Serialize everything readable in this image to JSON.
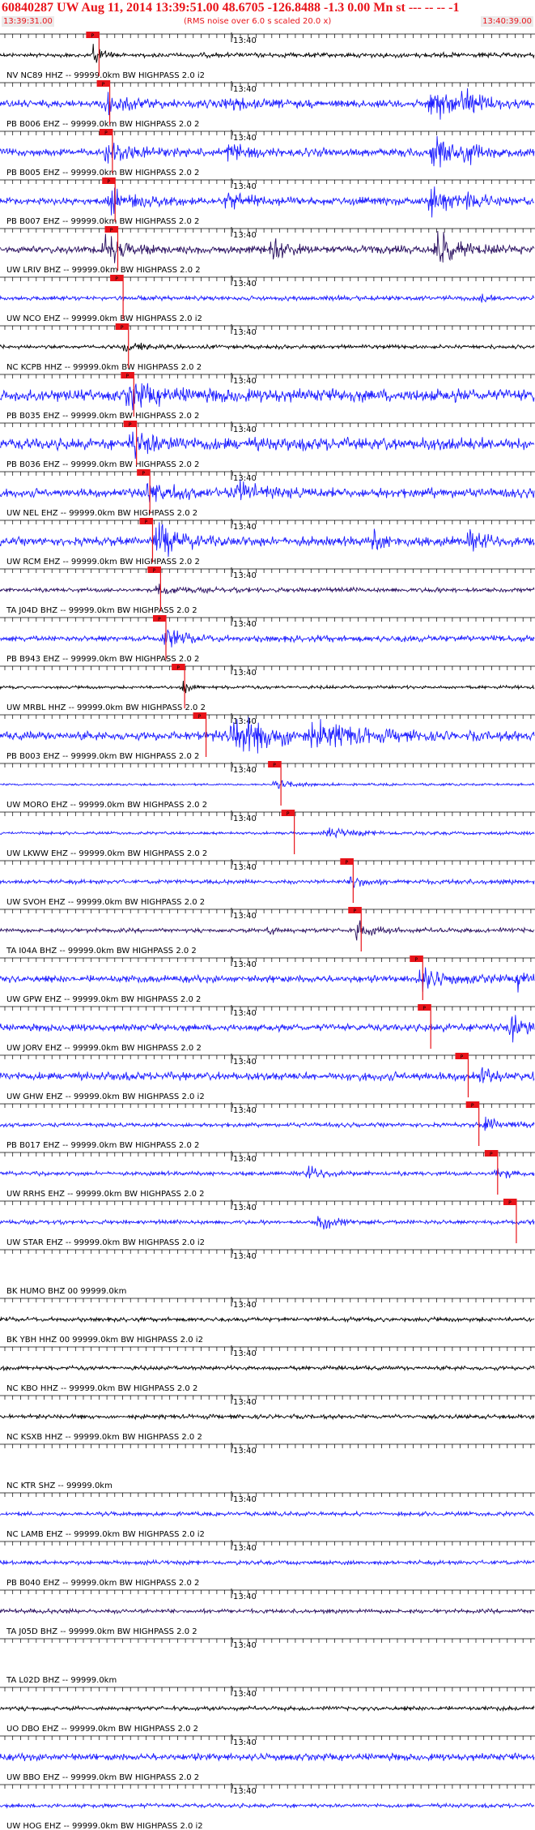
{
  "header": {
    "title": "60840287 UW Aug 11, 2014 13:39:51.00   48.6705 -126.8488 -1.3 0.00 Mn st --- -- --  -1",
    "start_time": "13:39:31.00",
    "rms_note": "(RMS noise over 6.0 s scaled 20.0 x)",
    "end_time": "13:40:39.00"
  },
  "colors": {
    "black": "#000000",
    "blue": "#1a1aff",
    "purple": "#2a1060",
    "pick": "#e8141a",
    "background": "#ffffff"
  },
  "chart_data": {
    "type": "line",
    "title": "60840287 UW Aug 11, 2014 13:39:51.00   48.6705 -126.8488 -1.3 0.00 Mn st --- -- --  -1",
    "x_start": "13:39:31.00",
    "x_end": "13:40:39.00",
    "x_tick_label": "13:40",
    "grid": false,
    "pick_label": "P",
    "traces": [
      {
        "label": "NV NC89 HHZ -- 99999.0km BW  HIGHPASS  2.0 i2",
        "color": "black",
        "amp": 3,
        "pick": 0.17,
        "events": [
          [
            0.175,
            14,
            0.018
          ]
        ]
      },
      {
        "label": "PB B006 EHZ -- 99999.0km BW  HIGHPASS  2.0  2",
        "color": "blue",
        "amp": 5,
        "pick": 0.19,
        "events": [
          [
            0.2,
            12,
            0.05
          ],
          [
            0.42,
            8,
            0.04
          ],
          [
            0.81,
            22,
            0.04
          ],
          [
            0.87,
            18,
            0.03
          ]
        ]
      },
      {
        "label": "PB B005 EHZ -- 99999.0km BW  HIGHPASS  2.0  2",
        "color": "blue",
        "amp": 5,
        "pick": 0.195,
        "events": [
          [
            0.205,
            14,
            0.05
          ],
          [
            0.43,
            9,
            0.04
          ],
          [
            0.81,
            20,
            0.04
          ],
          [
            0.87,
            14,
            0.03
          ]
        ]
      },
      {
        "label": "PB B007 EHZ -- 99999.0km BW  HIGHPASS  2.0  2",
        "color": "blue",
        "amp": 5,
        "pick": 0.2,
        "events": [
          [
            0.21,
            13,
            0.05
          ],
          [
            0.43,
            8,
            0.04
          ],
          [
            0.81,
            18,
            0.04
          ],
          [
            0.87,
            13,
            0.03
          ]
        ]
      },
      {
        "label": "UW LRIV BHZ -- 99999.0km BW  HIGHPASS  2.0  2",
        "color": "purple",
        "amp": 5,
        "pick": 0.205,
        "events": [
          [
            0.2,
            16,
            0.04
          ],
          [
            0.51,
            12,
            0.03
          ],
          [
            0.82,
            22,
            0.04
          ]
        ]
      },
      {
        "label": "UW NCO EHZ -- 99999.0km BW  HIGHPASS  2.0 i2",
        "color": "blue",
        "amp": 3,
        "pick": 0.215,
        "events": [
          [
            0.9,
            6,
            0.01
          ]
        ]
      },
      {
        "label": "NC KCPB HHZ -- 99999.0km BW  HIGHPASS  2.0  2",
        "color": "black",
        "amp": 2.5,
        "pick": 0.225,
        "events": [
          [
            0.24,
            4,
            0.05
          ]
        ]
      },
      {
        "label": "PB B035 EHZ -- 99999.0km BW  HIGHPASS  2.0  2",
        "color": "blue",
        "amp": 8,
        "pick": 0.235,
        "events": [
          [
            0.25,
            12,
            0.06
          ]
        ]
      },
      {
        "label": "PB B036 EHZ -- 99999.0km BW  HIGHPASS  2.0  2",
        "color": "blue",
        "amp": 8,
        "pick": 0.24,
        "events": [
          [
            0.255,
            12,
            0.06
          ]
        ]
      },
      {
        "label": "UW NEL EHZ -- 99999.0km BW  HIGHPASS  2.0  2",
        "color": "blue",
        "amp": 6,
        "pick": 0.265,
        "events": [
          [
            0.28,
            14,
            0.05
          ],
          [
            0.45,
            10,
            0.05
          ]
        ]
      },
      {
        "label": "UW RCM EHZ -- 99999.0km BW  HIGHPASS  2.0  2",
        "color": "blue",
        "amp": 6,
        "pick": 0.27,
        "events": [
          [
            0.3,
            16,
            0.05
          ],
          [
            0.7,
            12,
            0.02
          ],
          [
            0.88,
            10,
            0.03
          ]
        ]
      },
      {
        "label": "TA J04D BHZ -- 99999.0km BW  HIGHPASS  2.0  2",
        "color": "purple",
        "amp": 3,
        "pick": 0.285,
        "events": [
          [
            0.3,
            6,
            0.04
          ]
        ]
      },
      {
        "label": "PB B943 EHZ -- 99999.0km BW  HIGHPASS  2.0  2",
        "color": "blue",
        "amp": 4,
        "pick": 0.295,
        "events": [
          [
            0.31,
            10,
            0.04
          ]
        ]
      },
      {
        "label": "UW MRBL HHZ -- 99999.0km BW  HIGHPASS  2.0  2",
        "color": "black",
        "amp": 2,
        "pick": 0.33,
        "events": [
          [
            0.345,
            10,
            0.015
          ]
        ]
      },
      {
        "label": "PB B003 EHZ -- 99999.0km BW  HIGHPASS  2.0  2",
        "color": "blue",
        "amp": 6,
        "pick": 0.37,
        "events": [
          [
            0.45,
            22,
            0.1
          ],
          [
            0.6,
            12,
            0.08
          ]
        ]
      },
      {
        "label": "UW MORO EHZ -- 99999.0km BW  HIGHPASS  2.0  2",
        "color": "blue",
        "amp": 1.5,
        "pick": 0.51,
        "events": [
          [
            0.52,
            4,
            0.05
          ]
        ]
      },
      {
        "label": "UW LKWW EHZ -- 99999.0km BW  HIGHPASS  2.0  2",
        "color": "blue",
        "amp": 2,
        "pick": 0.535,
        "events": [
          [
            0.62,
            5,
            0.06
          ]
        ]
      },
      {
        "label": "UW SVOH EHZ -- 99999.0km BW  HIGHPASS  2.0  2",
        "color": "blue",
        "amp": 3,
        "pick": 0.645,
        "events": [
          [
            0.66,
            8,
            0.03
          ]
        ]
      },
      {
        "label": "TA I04A BHZ -- 99999.0km BW  HIGHPASS  2.0  2",
        "color": "purple",
        "amp": 3,
        "pick": 0.66,
        "events": [
          [
            0.5,
            6,
            0.02
          ],
          [
            0.67,
            10,
            0.03
          ]
        ]
      },
      {
        "label": "UW GPW EHZ -- 99999.0km BW  HIGHPASS  2.0  2",
        "color": "blue",
        "amp": 5,
        "pick": 0.775,
        "events": [
          [
            0.79,
            14,
            0.04
          ],
          [
            0.97,
            12,
            0.02
          ]
        ]
      },
      {
        "label": "UW JORV EHZ -- 99999.0km BW  HIGHPASS  2.0  2",
        "color": "blue",
        "amp": 5,
        "pick": 0.79,
        "events": [
          [
            0.96,
            16,
            0.04
          ]
        ]
      },
      {
        "label": "UW GHW EHZ -- 99999.0km BW  HIGHPASS  2.0 i2",
        "color": "blue",
        "amp": 6,
        "pick": 0.86,
        "events": [
          [
            0.9,
            10,
            0.015
          ]
        ]
      },
      {
        "label": "PB B017 EHZ -- 99999.0km BW  HIGHPASS  2.0  2",
        "color": "blue",
        "amp": 3,
        "pick": 0.88,
        "events": [
          [
            0.91,
            8,
            0.03
          ]
        ]
      },
      {
        "label": "UW RRHS EHZ -- 99999.0km BW  HIGHPASS  2.0  2",
        "color": "blue",
        "amp": 3,
        "pick": 0.915,
        "events": [
          [
            0.58,
            8,
            0.04
          ],
          [
            0.93,
            6,
            0.03
          ]
        ]
      },
      {
        "label": "UW STAR EHZ -- 99999.0km BW  HIGHPASS  2.0 i2",
        "color": "blue",
        "amp": 3,
        "pick": 0.95,
        "events": [
          [
            0.6,
            10,
            0.04
          ]
        ]
      },
      {
        "label": "BK HUMO BHZ 00 99999.0km",
        "color": "black",
        "amp": 0,
        "pick": null,
        "events": []
      },
      {
        "label": "BK YBH HHZ 00 99999.0km BW  HIGHPASS  2.0 i2",
        "color": "black",
        "amp": 3,
        "pick": null,
        "events": []
      },
      {
        "label": "NC KBO HHZ -- 99999.0km BW  HIGHPASS  2.0  2",
        "color": "black",
        "amp": 3,
        "pick": null,
        "events": []
      },
      {
        "label": "NC KSXB HHZ -- 99999.0km BW  HIGHPASS  2.0  2",
        "color": "black",
        "amp": 3,
        "pick": null,
        "events": []
      },
      {
        "label": "NC KTR SHZ -- 99999.0km",
        "color": "black",
        "amp": 0,
        "pick": null,
        "events": []
      },
      {
        "label": "NC LAMB EHZ -- 99999.0km BW  HIGHPASS  2.0 i2",
        "color": "blue",
        "amp": 3,
        "pick": null,
        "events": []
      },
      {
        "label": "PB B040 EHZ -- 99999.0km BW  HIGHPASS  2.0  2",
        "color": "blue",
        "amp": 3,
        "pick": null,
        "events": []
      },
      {
        "label": "TA J05D BHZ -- 99999.0km BW  HIGHPASS  2.0  2",
        "color": "purple",
        "amp": 3,
        "pick": null,
        "events": []
      },
      {
        "label": "TA L02D BHZ -- 99999.0km",
        "color": "black",
        "amp": 0,
        "pick": null,
        "events": []
      },
      {
        "label": "UO DBO EHZ -- 99999.0km BW  HIGHPASS  2.0  2",
        "color": "black",
        "amp": 3,
        "pick": null,
        "events": []
      },
      {
        "label": "UW BBO EHZ -- 99999.0km BW  HIGHPASS  2.0  2",
        "color": "blue",
        "amp": 5,
        "pick": null,
        "events": []
      },
      {
        "label": "UW HOG EHZ -- 99999.0km BW  HIGHPASS  2.0 i2",
        "color": "blue",
        "amp": 3,
        "pick": null,
        "events": []
      }
    ]
  }
}
